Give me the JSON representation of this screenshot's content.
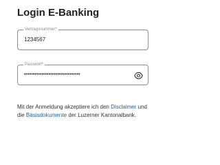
{
  "login": {
    "title": "Login E-Banking",
    "contract_field": {
      "label": "Vertragsnummer*",
      "value": "1234567"
    },
    "password_field": {
      "label": "Passwort*",
      "masked_value": "••••••••••••••••••••••••••••••••",
      "toggle_icon": "eye-icon"
    },
    "consent": {
      "text_before": "Mit der Anmeldung akzeptiere ich den ",
      "link_disclaimer": "Disclaimer",
      "text_middle": " und die ",
      "link_basisdokumente": "Basisdokumente",
      "text_after": " der Luzerner Kantonalbank."
    }
  },
  "colors": {
    "link": "#1e5fa8",
    "border": "#8e8e8e",
    "text": "#222222"
  }
}
